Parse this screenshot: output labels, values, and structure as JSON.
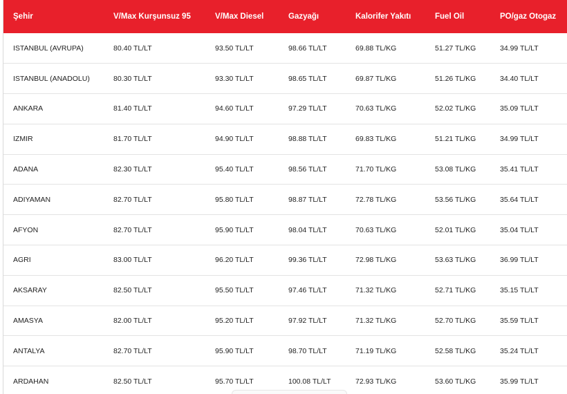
{
  "table": {
    "headers": [
      "Şehir",
      "V/Max Kurşunsuz 95",
      "V/Max Diesel",
      "Gazyağı",
      "Kalorifer Yakıtı",
      "Fuel Oil",
      "PO/gaz Otogaz"
    ],
    "rows": [
      [
        "ISTANBUL (AVRUPA)",
        "80.40 TL/LT",
        "93.50 TL/LT",
        "98.66 TL/LT",
        "69.88 TL/KG",
        "51.27 TL/KG",
        "34.99 TL/LT"
      ],
      [
        "ISTANBUL (ANADOLU)",
        "80.30 TL/LT",
        "93.30 TL/LT",
        "98.65 TL/LT",
        "69.87 TL/KG",
        "51.26 TL/KG",
        "34.40 TL/LT"
      ],
      [
        "ANKARA",
        "81.40 TL/LT",
        "94.60 TL/LT",
        "97.29 TL/LT",
        "70.63 TL/KG",
        "52.02 TL/KG",
        "35.09 TL/LT"
      ],
      [
        "IZMIR",
        "81.70 TL/LT",
        "94.90 TL/LT",
        "98.88 TL/LT",
        "69.83 TL/KG",
        "51.21 TL/KG",
        "34.99 TL/LT"
      ],
      [
        "ADANA",
        "82.30 TL/LT",
        "95.40 TL/LT",
        "98.56 TL/LT",
        "71.70 TL/KG",
        "53.08 TL/KG",
        "35.41 TL/LT"
      ],
      [
        "ADIYAMAN",
        "82.70 TL/LT",
        "95.80 TL/LT",
        "98.87 TL/LT",
        "72.78 TL/KG",
        "53.56 TL/KG",
        "35.64 TL/LT"
      ],
      [
        "AFYON",
        "82.70 TL/LT",
        "95.90 TL/LT",
        "98.04 TL/LT",
        "70.63 TL/KG",
        "52.01 TL/KG",
        "35.04 TL/LT"
      ],
      [
        "AGRI",
        "83.00 TL/LT",
        "96.20 TL/LT",
        "99.36 TL/LT",
        "72.98 TL/KG",
        "53.63 TL/KG",
        "36.99 TL/LT"
      ],
      [
        "AKSARAY",
        "82.50 TL/LT",
        "95.50 TL/LT",
        "97.46 TL/LT",
        "71.32 TL/KG",
        "52.71 TL/KG",
        "35.15 TL/LT"
      ],
      [
        "AMASYA",
        "82.00 TL/LT",
        "95.20 TL/LT",
        "97.92 TL/LT",
        "71.32 TL/KG",
        "52.70 TL/KG",
        "35.59 TL/LT"
      ],
      [
        "ANTALYA",
        "82.70 TL/LT",
        "95.90 TL/LT",
        "98.70 TL/LT",
        "71.19 TL/KG",
        "52.58 TL/KG",
        "35.24 TL/LT"
      ],
      [
        "ARDAHAN",
        "82.50 TL/LT",
        "95.70 TL/LT",
        "100.08 TL/LT",
        "72.93 TL/KG",
        "53.60 TL/KG",
        "35.99 TL/LT"
      ]
    ]
  },
  "colors": {
    "header_bg": "#e8202b",
    "header_text": "#ffffff",
    "row_divider": "#e3e3e3"
  }
}
